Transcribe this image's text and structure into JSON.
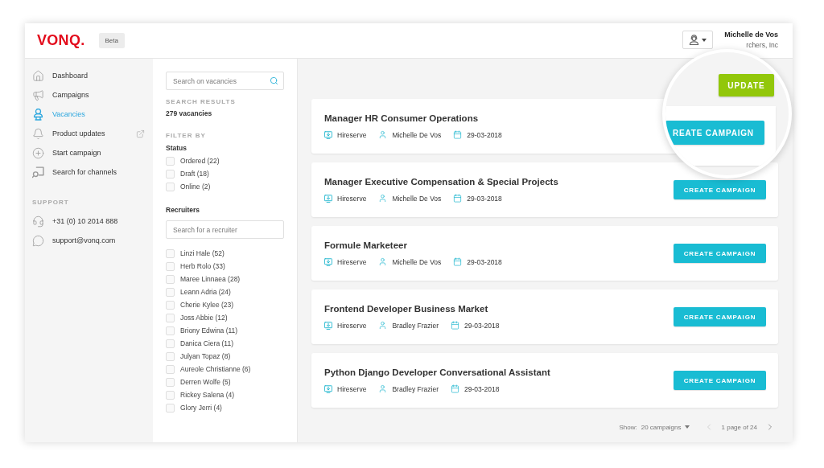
{
  "header": {
    "logo": "VONQ.",
    "badge": "Beta",
    "user": {
      "name": "Michelle de Vos",
      "company": "rchers, Inc"
    }
  },
  "sidebar": {
    "items": [
      {
        "label": "Dashboard",
        "selected": false,
        "external": false
      },
      {
        "label": "Campaigns",
        "selected": false,
        "external": false
      },
      {
        "label": "Vacancies",
        "selected": true,
        "external": false
      },
      {
        "label": "Product updates",
        "selected": false,
        "external": true
      },
      {
        "label": "Start campaign",
        "selected": false,
        "external": false
      },
      {
        "label": "Search for channels",
        "selected": false,
        "external": false
      }
    ],
    "support": {
      "title": "SUPPORT",
      "items": [
        "+31 (0) 10 2014 888",
        "support@vonq.com"
      ]
    }
  },
  "filters": {
    "search": {
      "placeholder": "Search on vacancies"
    },
    "results_title": "SEARCH RESULTS",
    "results_count": "279 vacancies",
    "filter_title": "FILTER BY",
    "status": {
      "title": "Status",
      "options": [
        {
          "label": "Ordered (22)",
          "checked": false
        },
        {
          "label": "Draft (18)",
          "checked": false
        },
        {
          "label": "Online (2)",
          "checked": false
        }
      ]
    },
    "recruiters": {
      "title": "Recruiters",
      "search": {
        "placeholder": "Search for a recruiter"
      },
      "options": [
        {
          "label": "Linzi Hale (52)",
          "checked": false
        },
        {
          "label": "Herb Rolo (33)",
          "checked": false
        },
        {
          "label": "Maree Linnaea (28)",
          "checked": false
        },
        {
          "label": "Leann Adria (24)",
          "checked": false
        },
        {
          "label": "Cherie Kylee (23)",
          "checked": false
        },
        {
          "label": "Joss Abbie (12)",
          "checked": false
        },
        {
          "label": "Briony Edwina (11)",
          "checked": false
        },
        {
          "label": "Danica Ciera (11)",
          "checked": false
        },
        {
          "label": "Julyan Topaz (8)",
          "checked": false
        },
        {
          "label": "Aureole Christianne (6)",
          "checked": false
        },
        {
          "label": "Derren Wolfe (5)",
          "checked": false
        },
        {
          "label": "Rickey Salena (4)",
          "checked": false
        },
        {
          "label": "Glory Jerri (4)",
          "checked": false
        }
      ]
    }
  },
  "vacancies": [
    {
      "title": "Manager HR Consumer Operations",
      "source": "Hireserve",
      "recruiter": "Michelle De Vos",
      "date": "29-03-2018"
    },
    {
      "title": "Manager Executive Compensation & Special Projects",
      "source": "Hireserve",
      "recruiter": "Michelle De Vos",
      "date": "29-03-2018",
      "button": "CREATE CAMPAIGN"
    },
    {
      "title": "Formule Marketeer",
      "source": "Hireserve",
      "recruiter": "Michelle De Vos",
      "date": "29-03-2018",
      "button": "CREATE CAMPAIGN"
    },
    {
      "title": "Frontend Developer Business Market",
      "source": "Hireserve",
      "recruiter": "Bradley Frazier",
      "date": "29-03-2018",
      "button": "CREATE CAMPAIGN"
    },
    {
      "title": "Python Django Developer Conversational Assistant",
      "source": "Hireserve",
      "recruiter": "Bradley Frazier",
      "date": "29-03-2018",
      "button": "CREATE CAMPAIGN"
    }
  ],
  "pagination": {
    "show_label": "Show:",
    "page_size": "20 campaigns",
    "page_info": "1 page of 24"
  },
  "magnifier": {
    "update_button": "UPDATE",
    "campaign_button": "REATE CAMPAIGN"
  }
}
